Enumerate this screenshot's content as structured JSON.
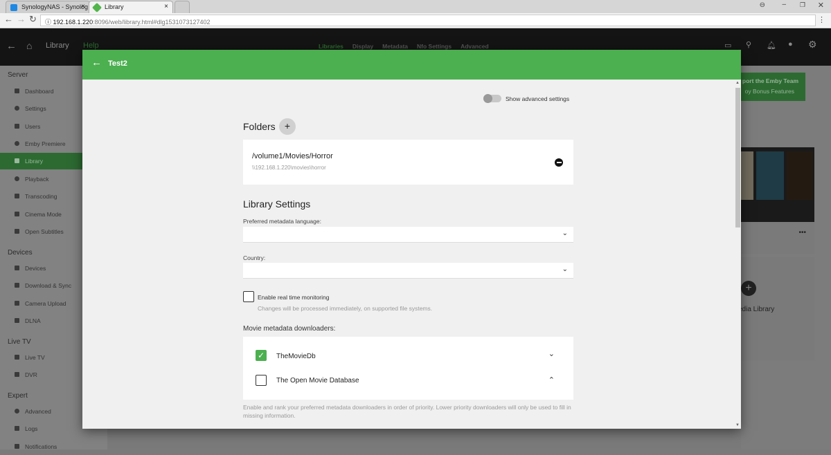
{
  "browser": {
    "tabs": [
      {
        "label": "SynologyNAS - Synolog",
        "favicon_color": "#1e88e5"
      },
      {
        "label": "Library",
        "favicon_color": "#52b54b"
      }
    ],
    "close_glyph": "×",
    "url_host": "192.168.1.220",
    "url_rest": ":8096/web/library.html#dlg1531073127402"
  },
  "app_header": {
    "title": "Library",
    "help": "Help",
    "tabs": [
      "Libraries",
      "Display",
      "Metadata",
      "Nfo Settings",
      "Advanced"
    ]
  },
  "sidebar": {
    "sections": [
      {
        "title": "Server",
        "items": [
          "Dashboard",
          "Settings",
          "Users",
          "Emby Premiere",
          "Library",
          "Playback",
          "Transcoding",
          "Cinema Mode",
          "Open Subtitles"
        ]
      },
      {
        "title": "Devices",
        "items": [
          "Devices",
          "Download & Sync",
          "Camera Upload",
          "DLNA"
        ]
      },
      {
        "title": "Live TV",
        "items": [
          "Live TV",
          "DVR"
        ]
      },
      {
        "title": "Expert",
        "items": [
          "Advanced",
          "Logs",
          "Notifications"
        ]
      }
    ],
    "active": "Library"
  },
  "background": {
    "support_title": "port the Emby Team",
    "support_sub": "oy Bonus Features",
    "new_library": "edia Library",
    "more": "•••"
  },
  "dialog": {
    "title": "Test2",
    "show_advanced": "Show advanced settings",
    "folders_title": "Folders",
    "folders": [
      {
        "path": "/volume1/Movies/Horror",
        "network_path": "\\\\192.168.1.220\\movies\\horror"
      }
    ],
    "library_settings_title": "Library Settings",
    "metadata_language_label": "Preferred metadata language:",
    "metadata_language_value": "",
    "country_label": "Country:",
    "country_value": "",
    "realtime_label": "Enable real time monitoring",
    "realtime_checked": false,
    "realtime_hint": "Changes will be processed immediately, on supported file systems.",
    "downloaders_title": "Movie metadata downloaders:",
    "downloaders": [
      {
        "name": "TheMovieDb",
        "checked": true
      },
      {
        "name": "The Open Movie Database",
        "checked": false
      }
    ],
    "downloaders_hint": "Enable and rank your preferred metadata downloaders in order of priority. Lower priority downloaders will only be used to fill in missing information.",
    "accent_color": "#4caf50"
  }
}
